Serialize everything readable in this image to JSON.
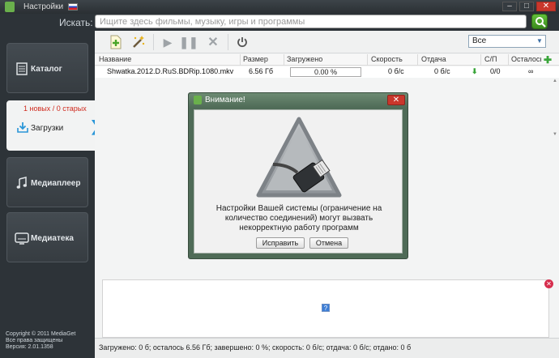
{
  "titlebar": {
    "settings": "Настройки"
  },
  "search": {
    "label": "Искать:",
    "placeholder": "Ищите здесь фильмы, музыку, игры и программы"
  },
  "sidebar": {
    "items": [
      {
        "label": "Каталог"
      },
      {
        "label": "Загрузки",
        "counts": "1 новых / 0 старых"
      },
      {
        "label": "Медиаплеер"
      },
      {
        "label": "Медиатека"
      }
    ],
    "copyright": [
      "Copyright © 2011 MediaGet",
      "Все права защищены",
      "Версия: 2.01.1358"
    ]
  },
  "toolbar": {
    "filter_value": "Все"
  },
  "table": {
    "columns": [
      "Название",
      "Размер",
      "Загружено",
      "Скорость",
      "Отдача",
      "С/П",
      "Осталось"
    ],
    "rows": [
      {
        "name": "Shwatka.2012.D.RuS.BDRip.1080.mkv",
        "size": "6.56 Гб",
        "progress": "0.00 %",
        "speed": "0 б/с",
        "upload": "0 б/с",
        "sp": "0/0",
        "remaining": "∞"
      }
    ]
  },
  "status": "Загружено: 0 б; осталось 6.56 Гб; завершено: 0 %; скорость: 0 б/с; отдача: 0 б/с; отдано: 0 б",
  "dialog": {
    "title": "Внимание!",
    "message": "Настройки Вашей системы (ограничение на количество соединений) могут вызвать некорректную работу программ",
    "fix_button": "Исправить",
    "cancel_button": "Отмена"
  },
  "colors": {
    "accent": "#2a96d8",
    "counts": "#d02a1e",
    "sidebar": "#2d3338"
  }
}
